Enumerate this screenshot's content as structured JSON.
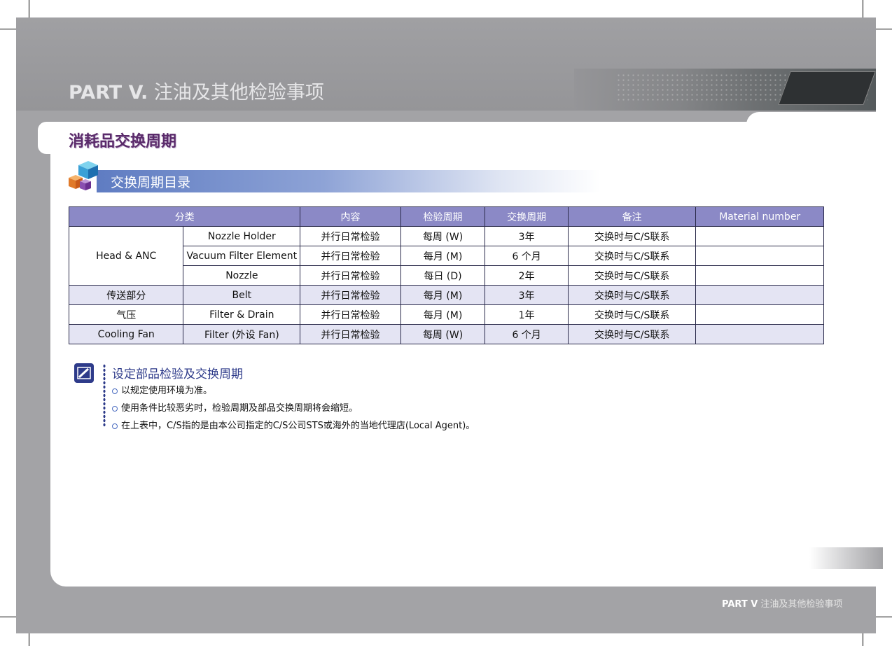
{
  "header": {
    "part_label": "PART V.",
    "part_title": "注油及其他检验事项"
  },
  "section": {
    "title": "消耗品交换周期",
    "subheader": "交换周期目录"
  },
  "table": {
    "headers": [
      "分类",
      "内容",
      "检验周期",
      "交换周期",
      "备注",
      "Material number"
    ],
    "head_anc": "Head & ANC",
    "rows": [
      {
        "item": "Nozzle Holder",
        "content": "并行日常检验",
        "inspect": "每周 (W)",
        "exchange": "3年",
        "note": "交换时与C/S联系",
        "material": ""
      },
      {
        "item": "Vacuum Filter Element",
        "content": "并行日常检验",
        "inspect": "每月 (M)",
        "exchange": "6 个月",
        "note": "交换时与C/S联系",
        "material": ""
      },
      {
        "item": "Nozzle",
        "content": "并行日常检验",
        "inspect": "每日 (D)",
        "exchange": "2年",
        "note": "交换时与C/S联系",
        "material": ""
      },
      {
        "category": "传送部分",
        "item": "Belt",
        "content": "并行日常检验",
        "inspect": "每月 (M)",
        "exchange": "3年",
        "note": "交换时与C/S联系",
        "material": ""
      },
      {
        "category": "气压",
        "item": "Filter & Drain",
        "content": "并行日常检验",
        "inspect": "每月 (M)",
        "exchange": "1年",
        "note": "交换时与C/S联系",
        "material": ""
      },
      {
        "category": "Cooling Fan",
        "item": "Filter (外设 Fan)",
        "content": "并行日常检验",
        "inspect": "每周 (W)",
        "exchange": "6 个月",
        "note": "交换时与C/S联系",
        "material": ""
      }
    ]
  },
  "notes": {
    "title": "设定部品检验及交换周期",
    "items": [
      "以规定使用环境为准。",
      "使用条件比较恶劣时，检验周期及部品交换周期将会缩短。",
      "在上表中，C/S指的是由本公司指定的C/S公司STS或海外的当地代理店(Local Agent)。"
    ]
  },
  "footer": {
    "part_label": "PART V",
    "part_title": "注油及其他检验事项"
  },
  "colors": {
    "header_band": "#999999",
    "section_title": "#5a2a6a",
    "table_header": "#8b89c6",
    "table_shade": "#e4e4f3",
    "note_accent": "#2e3b8a"
  }
}
